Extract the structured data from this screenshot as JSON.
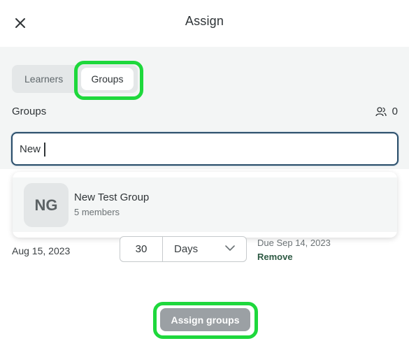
{
  "header": {
    "title": "Assign",
    "close_icon": "close-icon"
  },
  "tabs": {
    "learners": "Learners",
    "groups": "Groups",
    "active": "Groups"
  },
  "groups_section": {
    "label": "Groups",
    "count": "0",
    "count_icon": "people-icon"
  },
  "search": {
    "value": "New",
    "placeholder": ""
  },
  "dropdown": {
    "items": [
      {
        "initials": "NG",
        "name": "New Test Group",
        "members": "5 members"
      }
    ]
  },
  "schedule": {
    "start_date": "Aug 15, 2023",
    "duration_value": "30",
    "duration_unit": "Days",
    "due_text": "Due Sep 14, 2023",
    "remove_label": "Remove"
  },
  "footer": {
    "assign_label": "Assign groups"
  },
  "colors": {
    "highlight": "#1ed83c",
    "panel_bg": "#f3f5f5",
    "search_border": "#2b4f6b",
    "button_disabled": "#9ba0a4",
    "remove_link": "#2e5a44"
  }
}
